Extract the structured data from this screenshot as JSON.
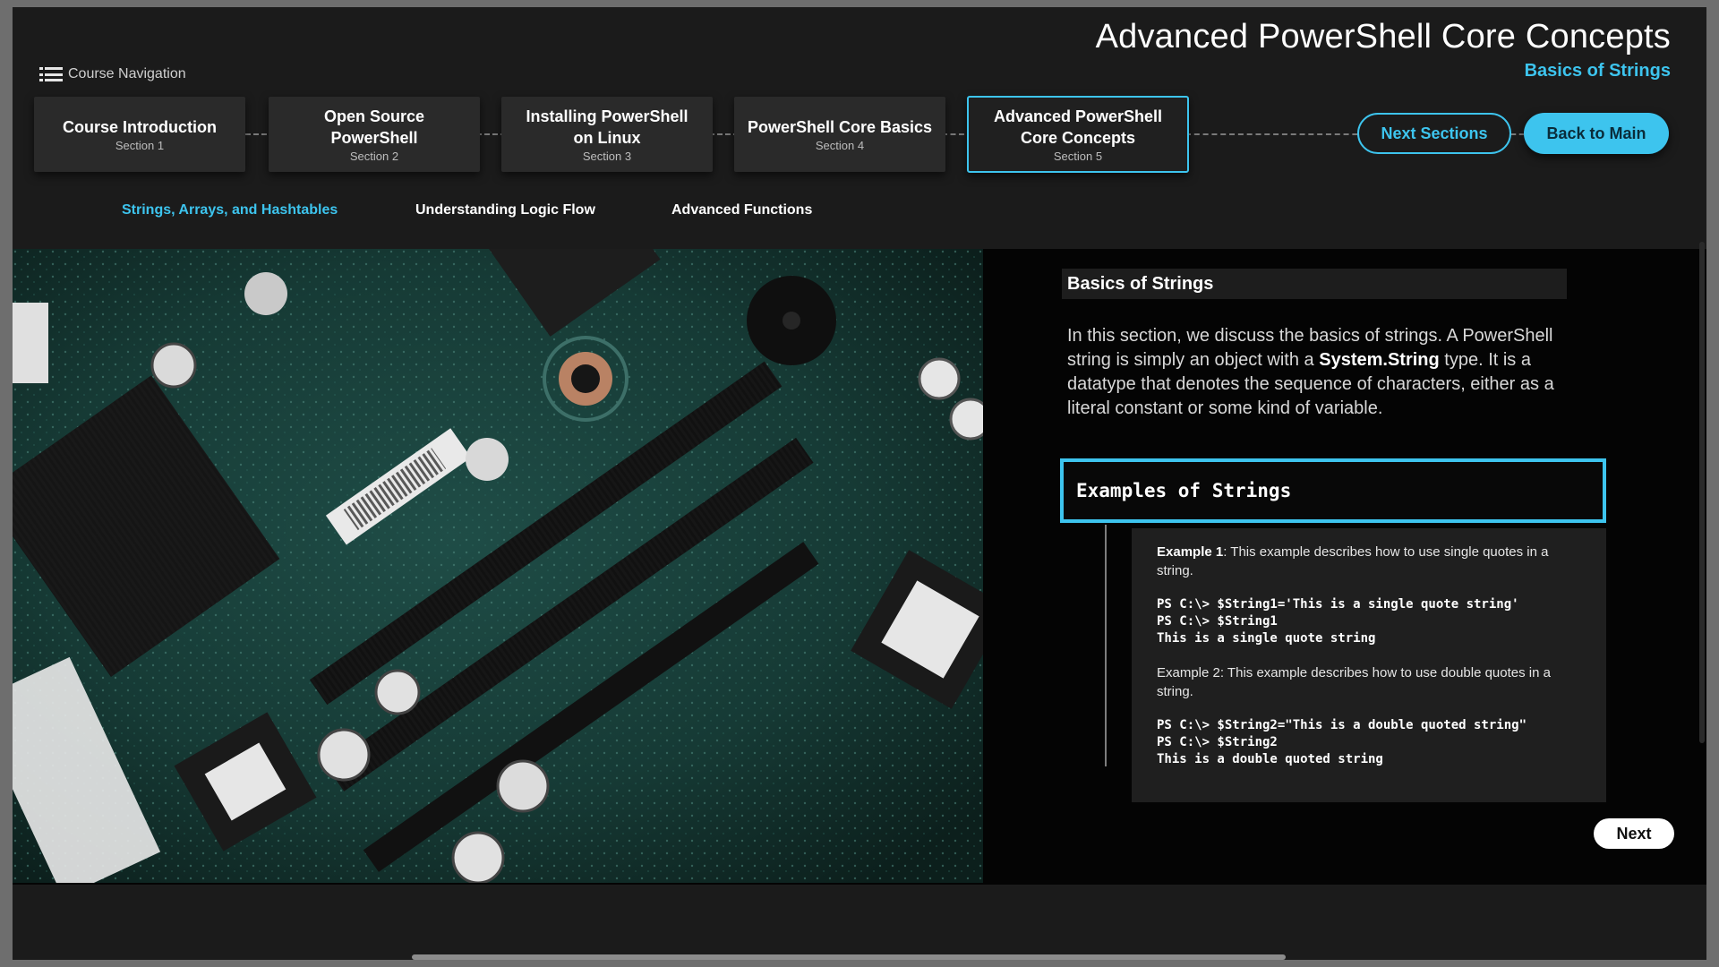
{
  "header": {
    "title": "Advanced PowerShell Core Concepts",
    "subtitle": "Basics of Strings",
    "nav_label": "Course Navigation"
  },
  "sections": [
    {
      "title": "Course Introduction",
      "section": "Section 1"
    },
    {
      "title": "Open Source PowerShell",
      "section": "Section 2"
    },
    {
      "title": "Installing PowerShell on Linux",
      "section": "Section 3"
    },
    {
      "title": "PowerShell Core Basics",
      "section": "Section 4"
    },
    {
      "title": "Advanced PowerShell Core Concepts",
      "section": "Section 5"
    }
  ],
  "buttons": {
    "next_sections": "Next Sections",
    "back_to_main": "Back to Main",
    "next": "Next"
  },
  "tabs": [
    {
      "label": "Strings, Arrays, and Hashtables",
      "active": true
    },
    {
      "label": "Understanding Logic Flow",
      "active": false
    },
    {
      "label": "Advanced Functions",
      "active": false
    }
  ],
  "panel": {
    "heading": "Basics of Strings",
    "intro_before": "In this section, we discuss the basics of strings. A PowerShell string is simply an object with a ",
    "intro_bold": "System.String",
    "intro_after": " type. It is a datatype that denotes the sequence of characters, either as a literal constant or some kind of variable.",
    "examples_title": "Examples of Strings",
    "example1_label": "Example 1",
    "example1_text": ": This example describes how to use single quotes in a string.",
    "example1_code": "PS C:\\> $String1='This is a single quote string'\nPS C:\\> $String1\nThis is a single quote string",
    "example2_text": "Example 2: This example describes how to use double quotes in a string.",
    "example2_code": "PS C:\\> $String2=\"This is a double quoted string\"\nPS C:\\> $String2\nThis is a double quoted string"
  },
  "colors": {
    "accent": "#3dc4ee",
    "background": "#1b1b1b",
    "content_bg": "#040404"
  }
}
